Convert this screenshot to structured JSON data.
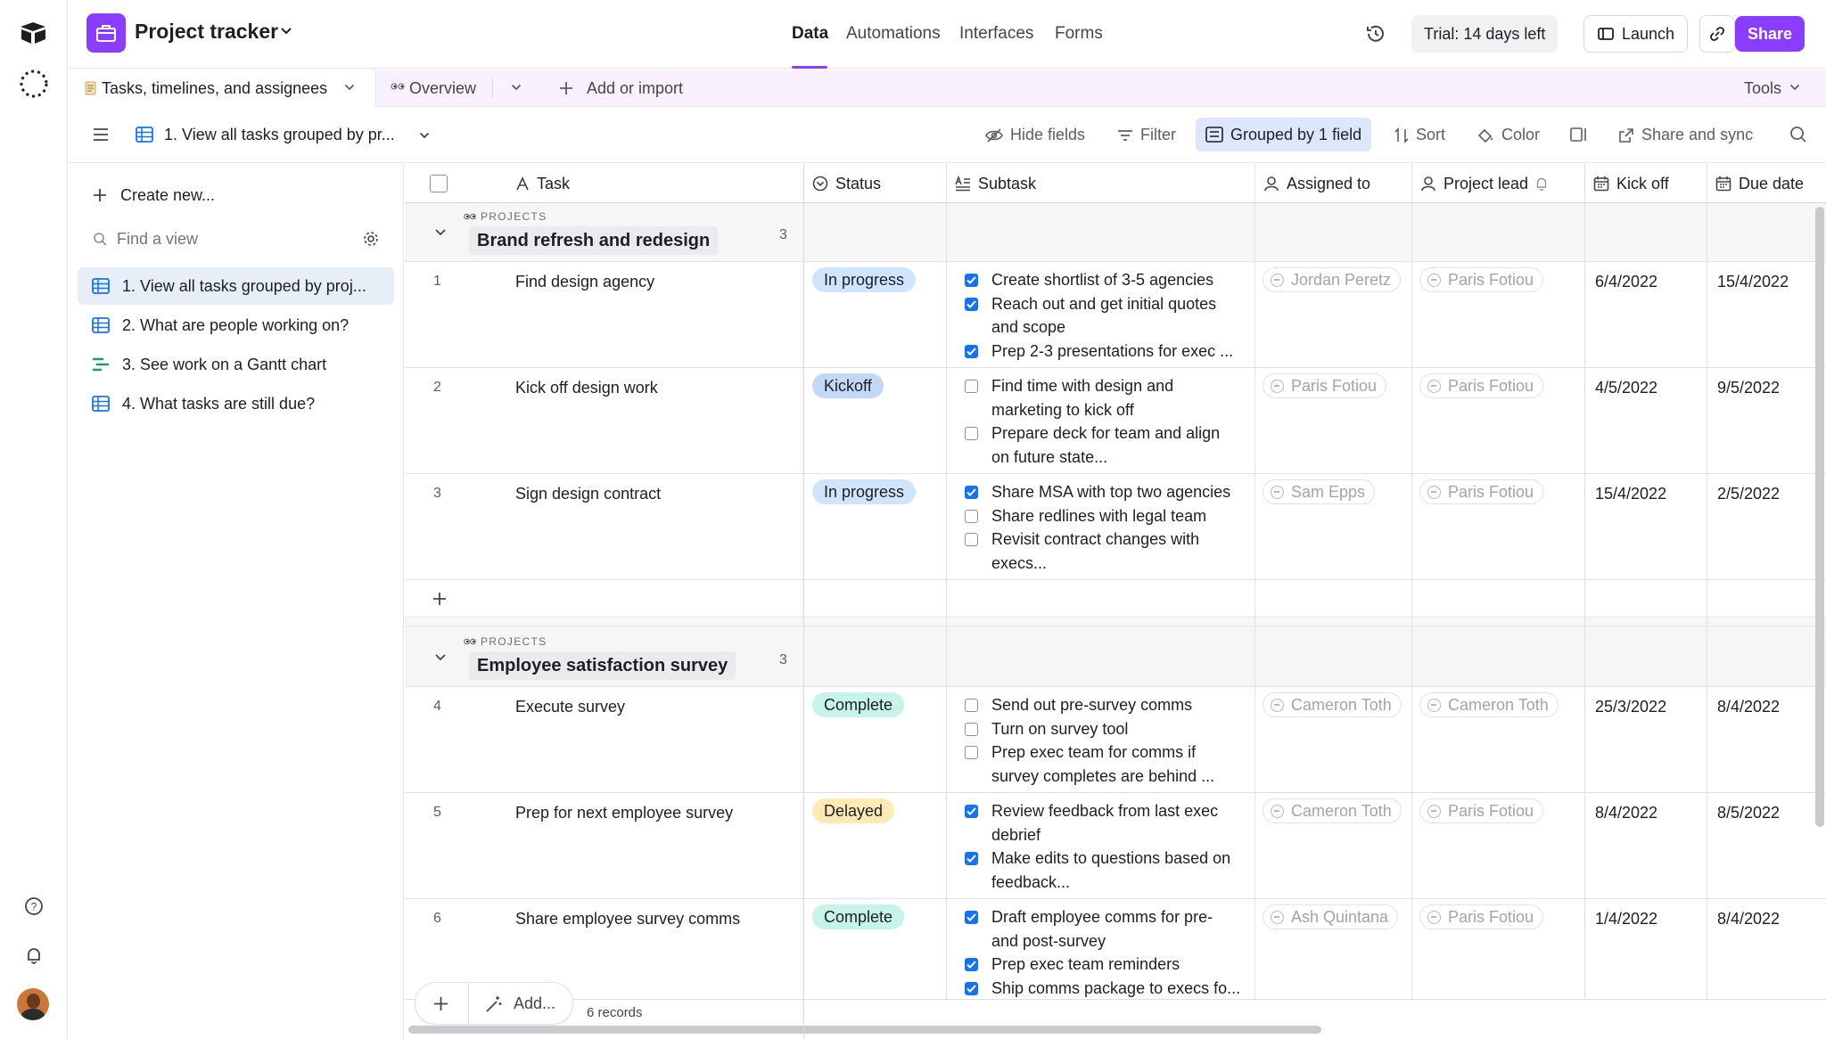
{
  "header": {
    "app_title": "Project tracker",
    "nav_tabs": [
      "Data",
      "Automations",
      "Interfaces",
      "Forms"
    ],
    "trial_label": "Trial: 14 days left",
    "launch_label": "Launch",
    "share_label": "Share",
    "accent_color": "#8b3dff"
  },
  "tabbar": {
    "table_tab": "Tasks, timelines, and assignees",
    "overview_tab": "Overview",
    "add_label": "Add or import",
    "tools_label": "Tools"
  },
  "viewbar": {
    "view_name": "1. View all tasks grouped by pr...",
    "hide_fields": "Hide fields",
    "filter": "Filter",
    "grouped": "Grouped by 1 field",
    "sort": "Sort",
    "color": "Color",
    "share_sync": "Share and sync"
  },
  "sidebar": {
    "create_new": "Create new...",
    "find_placeholder": "Find a view",
    "views": [
      "1. View all tasks grouped by proj...",
      "2. What are people working on?",
      "3. See work on a Gantt chart",
      "4. What tasks are still due?"
    ]
  },
  "grid": {
    "columns": [
      "Task",
      "Status",
      "Subtask",
      "Assigned to",
      "Project lead",
      "Kick off",
      "Due date"
    ],
    "group_field_label": "PROJECTS",
    "groups": [
      {
        "name": "Brand refresh and redesign",
        "count": "3",
        "rows": [
          {
            "num": "1",
            "task": "Find design agency",
            "status": "In progress",
            "subtasks": [
              {
                "checked": true,
                "lines": [
                  "Create shortlist of 3-5 agencies"
                ]
              },
              {
                "checked": true,
                "lines": [
                  "Reach out and get initial quotes",
                  "and scope"
                ]
              },
              {
                "checked": true,
                "lines": [
                  "Prep 2-3 presentations for exec ..."
                ]
              }
            ],
            "assigned": "Jordan Peretz",
            "lead": "Paris Fotiou",
            "kickoff": "6/4/2022",
            "due": "15/4/2022"
          },
          {
            "num": "2",
            "task": "Kick off design work",
            "status": "Kickoff",
            "subtasks": [
              {
                "checked": false,
                "lines": [
                  "Find time with design and",
                  "marketing to kick off"
                ]
              },
              {
                "checked": false,
                "lines": [
                  "Prepare deck for team and align",
                  "on future state..."
                ]
              }
            ],
            "assigned": "Paris Fotiou",
            "lead": "Paris Fotiou",
            "kickoff": "4/5/2022",
            "due": "9/5/2022"
          },
          {
            "num": "3",
            "task": "Sign design contract",
            "status": "In progress",
            "subtasks": [
              {
                "checked": true,
                "lines": [
                  "Share MSA with top two agencies"
                ]
              },
              {
                "checked": false,
                "lines": [
                  "Share redlines with legal team"
                ]
              },
              {
                "checked": false,
                "lines": [
                  "Revisit contract changes with",
                  "execs..."
                ]
              }
            ],
            "assigned": "Sam Epps",
            "lead": "Paris Fotiou",
            "kickoff": "15/4/2022",
            "due": "2/5/2022"
          }
        ]
      },
      {
        "name": "Employee satisfaction survey",
        "count": "3",
        "rows": [
          {
            "num": "4",
            "task": "Execute survey",
            "status": "Complete",
            "subtasks": [
              {
                "checked": false,
                "lines": [
                  "Send out pre-survey comms"
                ]
              },
              {
                "checked": false,
                "lines": [
                  "Turn on survey tool"
                ]
              },
              {
                "checked": false,
                "lines": [
                  "Prep exec team for comms if",
                  "survey completes are behind ..."
                ]
              }
            ],
            "assigned": "Cameron Toth",
            "lead": "Cameron Toth",
            "kickoff": "25/3/2022",
            "due": "8/4/2022"
          },
          {
            "num": "5",
            "task": "Prep for next employee survey",
            "status": "Delayed",
            "subtasks": [
              {
                "checked": true,
                "lines": [
                  "Review feedback from last exec",
                  "debrief"
                ]
              },
              {
                "checked": true,
                "lines": [
                  "Make edits to questions based on",
                  "feedback..."
                ]
              }
            ],
            "assigned": "Cameron Toth",
            "lead": "Paris Fotiou",
            "kickoff": "8/4/2022",
            "due": "8/5/2022"
          },
          {
            "num": "6",
            "task": "Share employee survey comms",
            "status": "Complete",
            "subtasks": [
              {
                "checked": true,
                "lines": [
                  "Draft employee comms for pre-",
                  "and post-survey"
                ]
              },
              {
                "checked": true,
                "lines": [
                  "Prep exec team reminders"
                ]
              },
              {
                "checked": true,
                "lines": [
                  "Ship comms package to execs fo..."
                ]
              }
            ],
            "assigned": "Ash Quintana",
            "lead": "Paris Fotiou",
            "kickoff": "1/4/2022",
            "due": "8/4/2022"
          }
        ]
      }
    ],
    "add_label": "Add...",
    "record_count": "6 records",
    "status_colors": {
      "In progress": "#cfe5fe",
      "Kickoff": "#c3d8f7",
      "Complete": "#c6f3ea",
      "Delayed": "#ffeab6"
    }
  }
}
